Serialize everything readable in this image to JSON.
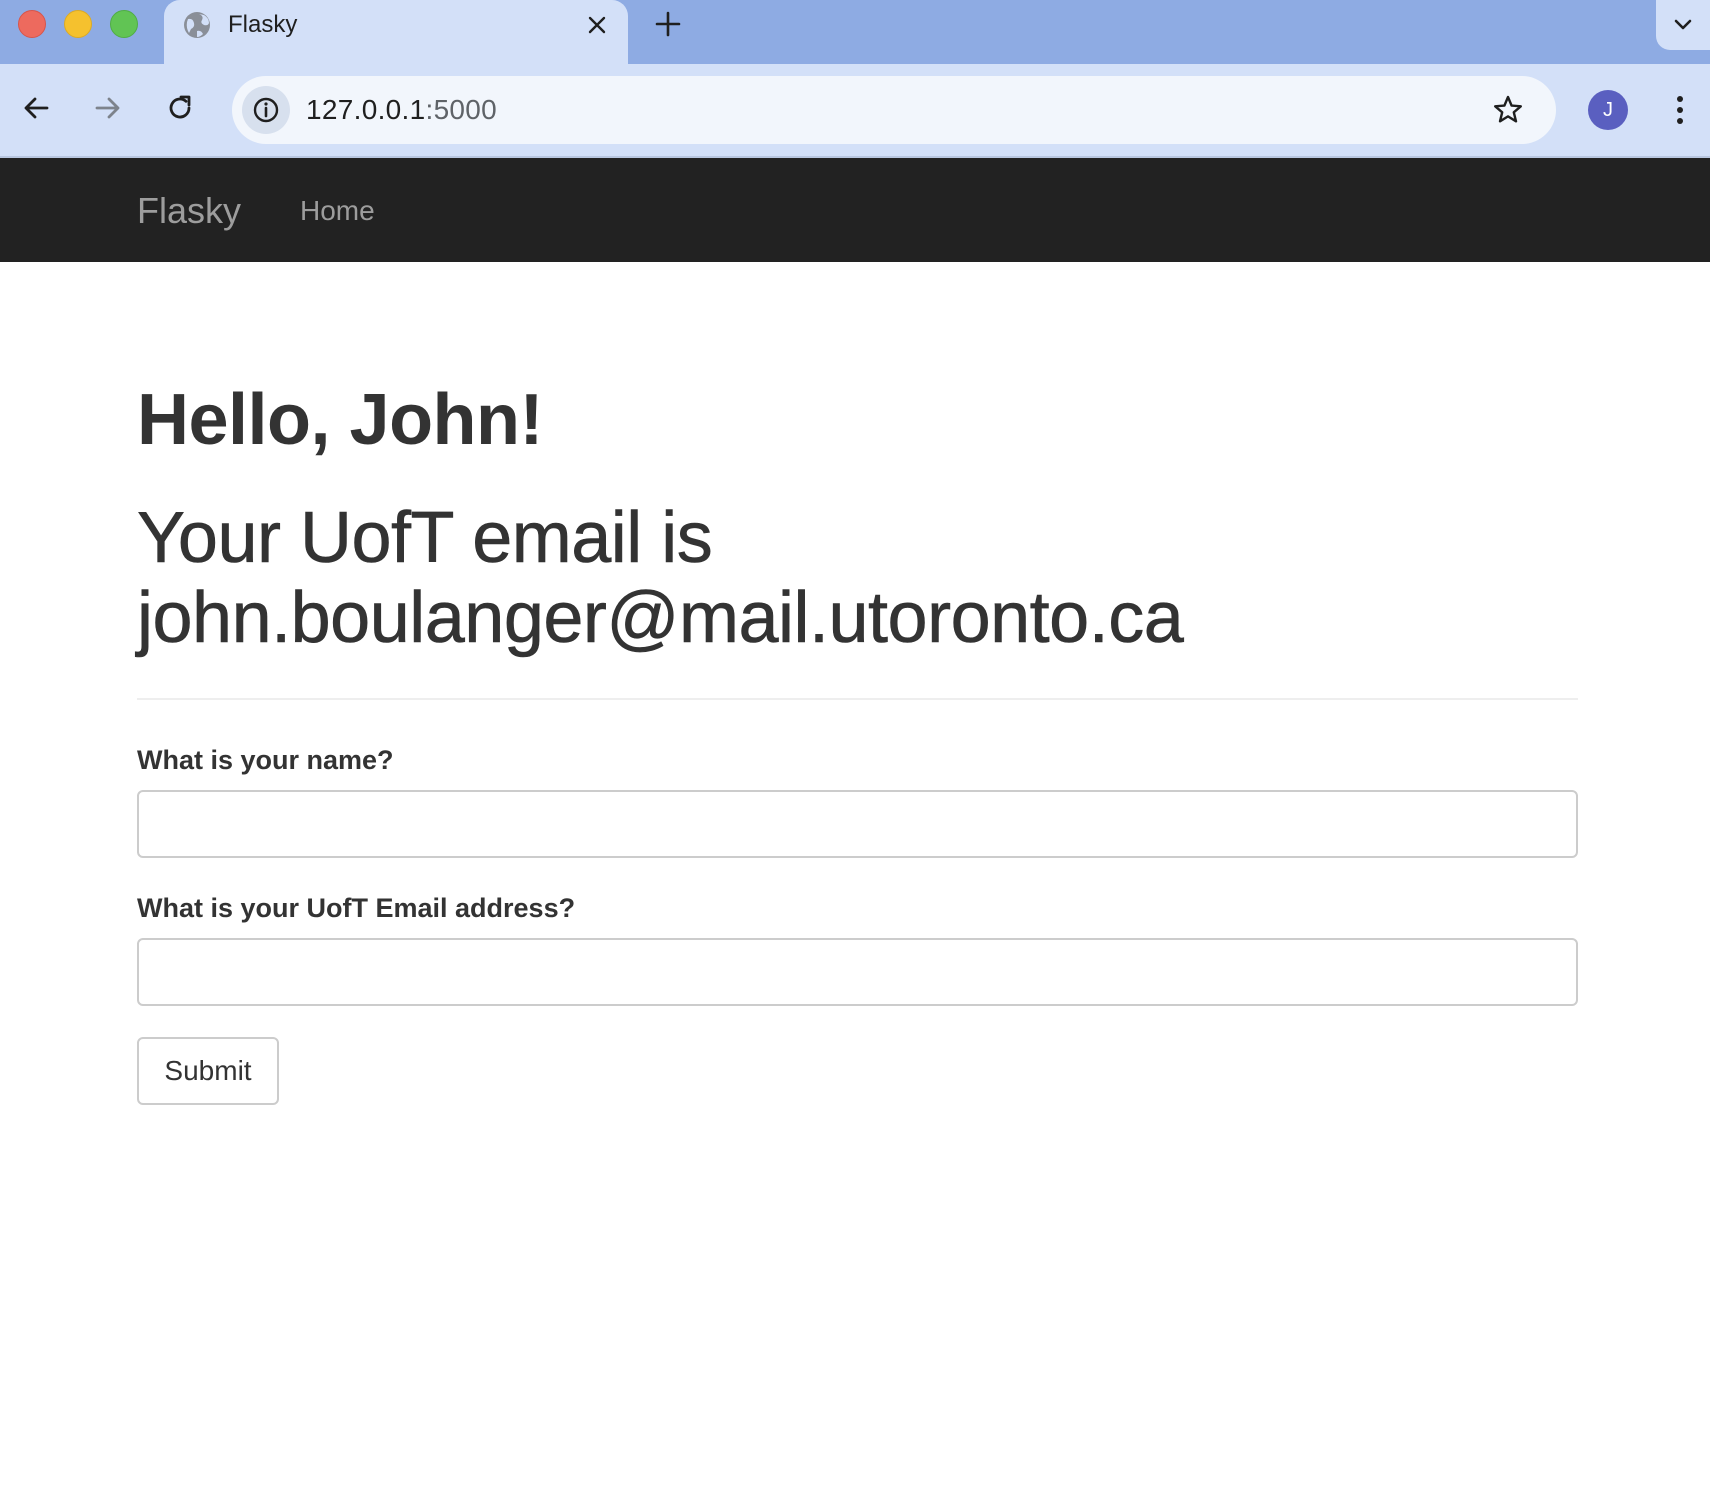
{
  "browser": {
    "tab": {
      "title": "Flasky",
      "favicon": "globe-icon"
    },
    "address_bar": {
      "host": "127.0.0.1",
      "port": ":5000"
    },
    "profile_initial": "J"
  },
  "navbar": {
    "brand": "Flasky",
    "links": [
      {
        "label": "Home"
      }
    ]
  },
  "page": {
    "greeting": "Hello, John!",
    "email_line_1": "Your UofT email is",
    "email_line_2": "john.boulanger@mail.utoronto.ca"
  },
  "form": {
    "name_label": "What is your name?",
    "name_value": "",
    "email_label": "What is your UofT Email address?",
    "email_value": "",
    "submit_label": "Submit"
  },
  "colors": {
    "navbar_bg": "#222222",
    "navbar_text": "#9d9d9d",
    "heading_text": "#333333",
    "tabstrip_bg": "#8eabe3",
    "toolbar_bg": "#d3e0f8",
    "avatar_bg": "#5a5fc0"
  }
}
